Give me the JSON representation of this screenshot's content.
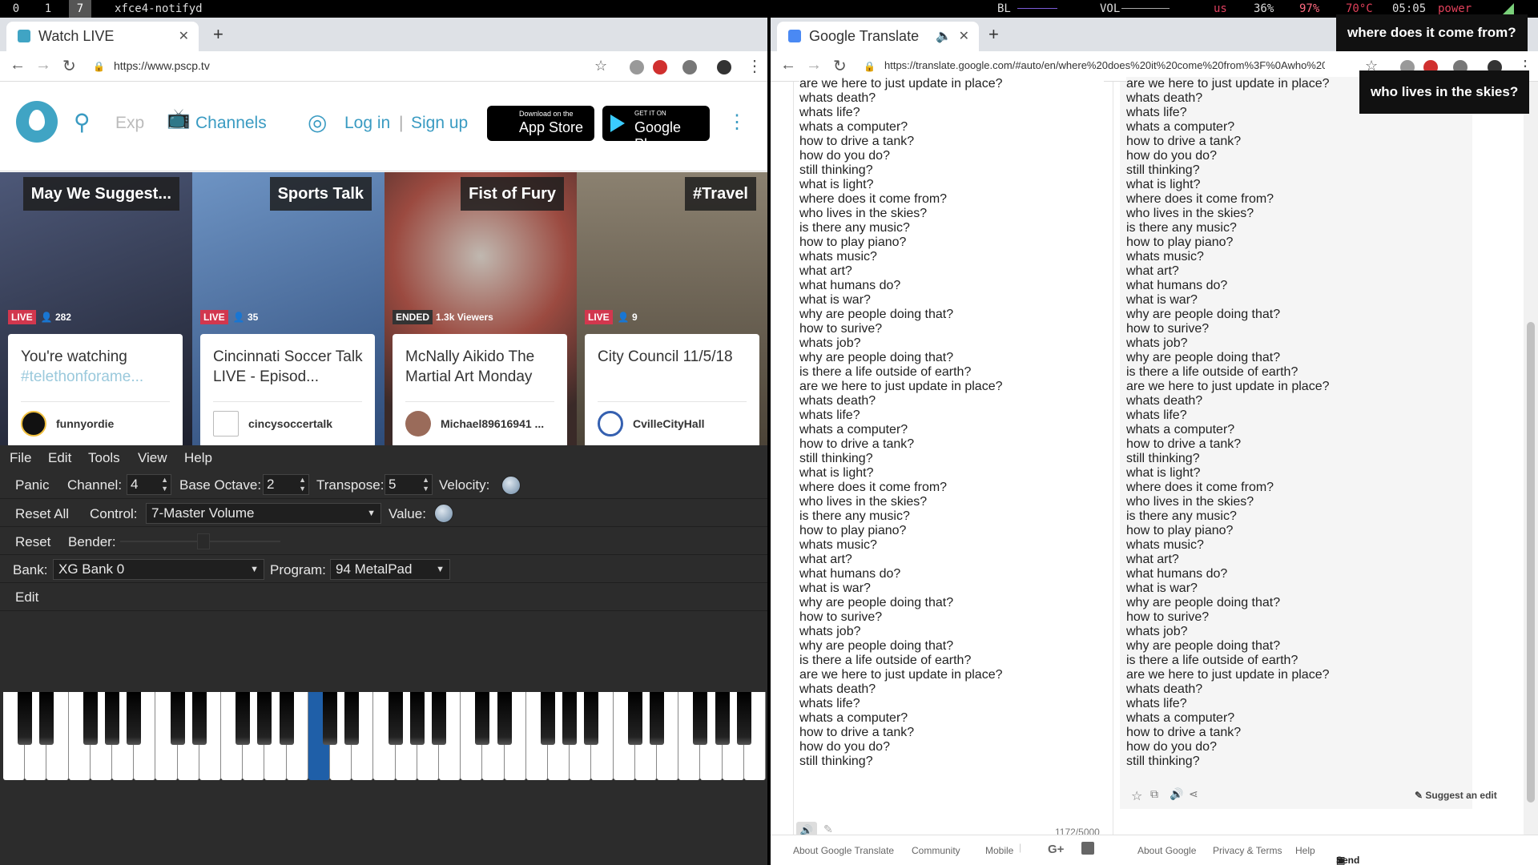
{
  "topbar": {
    "workspaces": [
      "0",
      "1",
      "7"
    ],
    "active_workspace": "7",
    "window_title": "xfce4-notifyd",
    "status": {
      "bl": "BL",
      "vol": "VOL",
      "lang": "us",
      "cpu": "36%",
      "mem": "97%",
      "temp": "70°C",
      "time": "05:05",
      "power": "power"
    }
  },
  "left_browser": {
    "tab_title": "Watch LIVE",
    "url": "https://www.pscp.tv"
  },
  "periscope": {
    "search_placeholder": "Exp",
    "channels": "Channels",
    "login": "Log in",
    "signup": "Sign up",
    "appstore_small": "Download on the",
    "appstore_big": "App Store",
    "googleplay_small": "GET IT ON",
    "googleplay_big": "Google Play",
    "cards": [
      {
        "category": "May We Suggest...",
        "status": "LIVE",
        "viewers": "282",
        "title": "You're watching",
        "subtitle": "#telethonforame...",
        "user": "funnyordie",
        "img_color": "#3a3d52"
      },
      {
        "category": "Sports Talk",
        "status": "LIVE",
        "viewers": "35",
        "title": "Cincinnati Soccer Talk LIVE - Episod...",
        "subtitle": "",
        "user": "cincysoccertalk",
        "img_color": "#3f6aa0"
      },
      {
        "category": "Fist of Fury",
        "status": "ENDED",
        "viewers": "1.3k Viewers",
        "title": "McNally Aikido The Martial Art Monday",
        "subtitle": "",
        "user": "Michael89616941 ...",
        "img_color": "#7a5248"
      },
      {
        "category": "#Travel",
        "status": "LIVE",
        "viewers": "9",
        "title": "City Council 11/5/18",
        "subtitle": "",
        "user": "CvilleCityHall",
        "img_color": "#6a6256"
      }
    ]
  },
  "vmpk": {
    "menu": [
      "File",
      "Edit",
      "Tools",
      "View",
      "Help"
    ],
    "panic": "Panic",
    "channel_label": "Channel:",
    "channel_value": "4",
    "base_octave_label": "Base Octave:",
    "base_octave_value": "2",
    "transpose_label": "Transpose:",
    "transpose_value": "5",
    "velocity_label": "Velocity:",
    "reset_all": "Reset All",
    "control_label": "Control:",
    "control_value": "7-Master Volume",
    "value_label": "Value:",
    "reset": "Reset",
    "bender_label": "Bender:",
    "bank_label": "Bank:",
    "bank_value": "XG Bank 0",
    "program_label": "Program:",
    "program_value": "94 MetalPad",
    "edit": "Edit",
    "selected_key_index": 14
  },
  "right_browser": {
    "tab_title": "Google Translate",
    "url": "https://translate.google.com/#auto/en/where%20does%20it%20come%20from%3F%0Awho%20lives...",
    "source_text": "are we here to just update in place?\nwhats death?\nwhats life?\nwhats a computer?\nhow to drive a tank?\nhow do you do?\nstill thinking?\nwhat is light?\nwhere does it come from?\nwho lives in the skies?\nis there any music?\nhow to play piano?\nwhats music?\nwhat art?\nwhat humans do?\nwhat is war?\nwhy are people doing that?\nhow to surive?\nwhats job?\nwhy are people doing that?\nis there a life outside of earth?\nare we here to just update in place?\nwhats death?\nwhats life?\nwhats a computer?\nhow to drive a tank?\nstill thinking?\nwhat is light?\nwhere does it come from?\nwho lives in the skies?\nis there any music?\nhow to play piano?\nwhats music?\nwhat art?\nwhat humans do?\nwhat is war?\nwhy are people doing that?\nhow to surive?\nwhats job?\nwhy are people doing that?\nis there a life outside of earth?\nare we here to just update in place?\nwhats death?\nwhats life?\nwhats a computer?\nhow to drive a tank?\nhow do you do?\nstill thinking?",
    "translated_text": "are we here to just update in place?\nwhats death?\nwhats life?\nwhats a computer?\nhow to drive a tank?\nhow do you do?\nstill thinking?\nwhat is light?\nwhere does it come from?\nwho lives in the skies?\nis there any music?\nhow to play piano?\nwhats music?\nwhat art?\nwhat humans do?\nwhat is war?\nwhy are people doing that?\nhow to surive?\nwhats job?\nwhy are people doing that?\nis there a life outside of earth?\nare we here to just update in place?\nwhats death?\nwhats life?\nwhats a computer?\nhow to drive a tank?\nstill thinking?\nwhat is light?\nwhere does it come from?\nwho lives in the skies?\nis there any music?\nhow to play piano?\nwhats music?\nwhat art?\nwhat humans do?\nwhat is war?\nwhy are people doing that?\nhow to surive?\nwhats job?\nwhy are people doing that?\nis there a life outside of earth?\nare we here to just update in place?\nwhats death?\nwhats life?\nwhats a computer?\nhow to drive a tank?\nhow do you do?\nstill thinking?",
    "char_count": "1172/5000",
    "suggest_edit": "Suggest an edit",
    "footer": {
      "about_translate": "About Google Translate",
      "community": "Community",
      "mobile": "Mobile",
      "about_google": "About Google",
      "privacy": "Privacy & Terms",
      "help": "Help",
      "feedback": "Send feedback"
    }
  },
  "notifications": [
    "where does it come from?",
    "who lives in the skies?"
  ]
}
